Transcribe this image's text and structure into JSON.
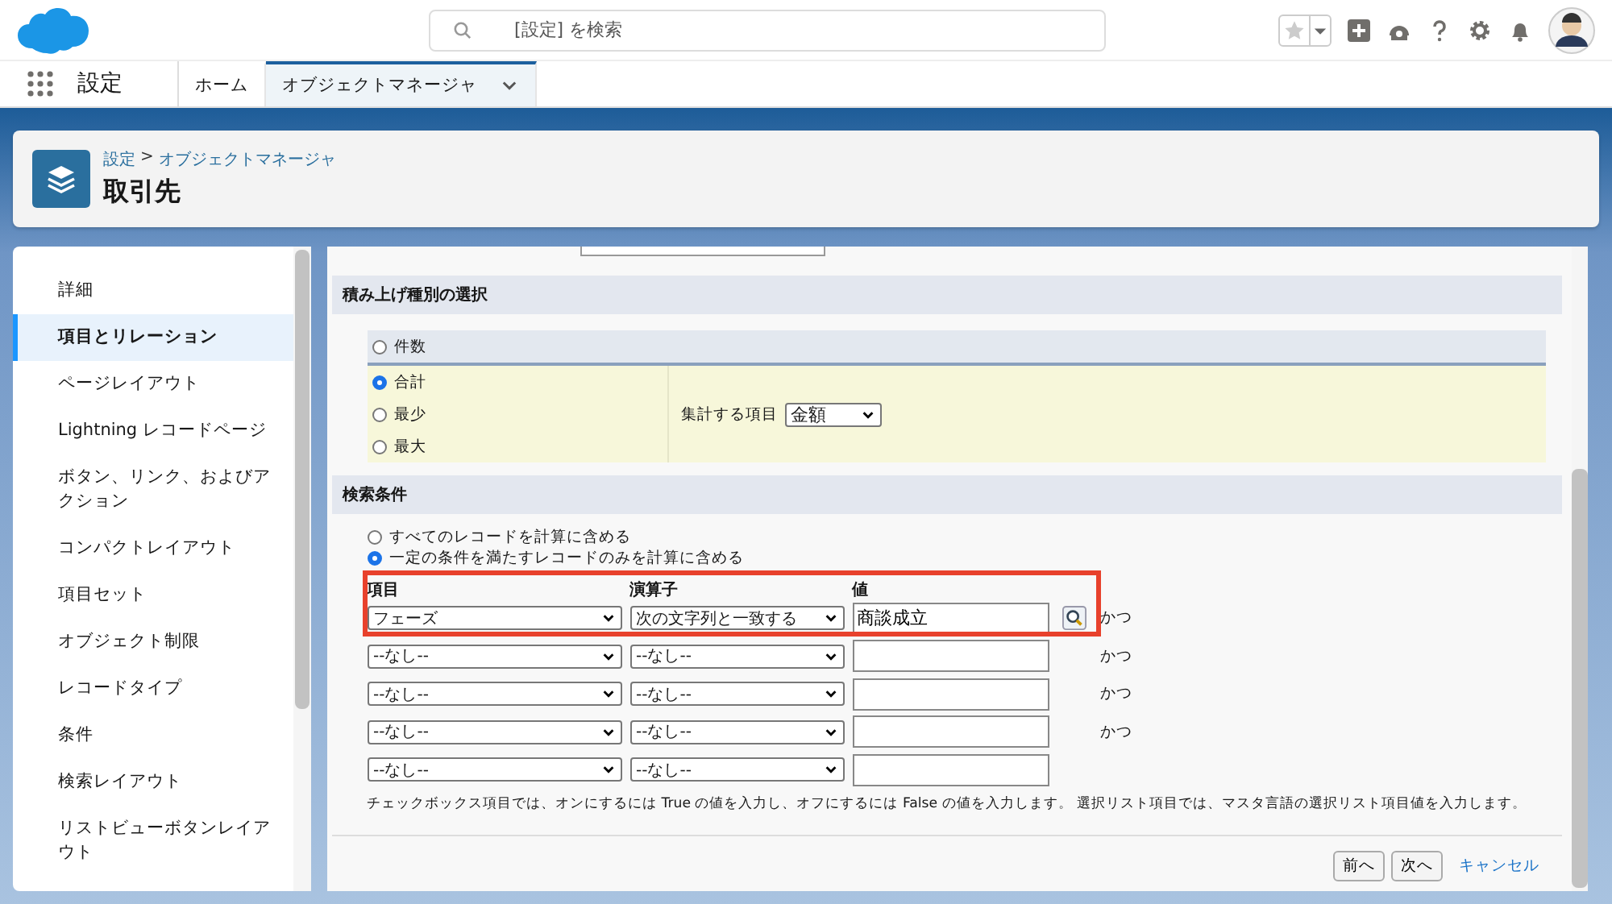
{
  "header": {
    "search_placeholder": "[設定] を検索"
  },
  "nav": {
    "app_title": "設定",
    "tabs": [
      {
        "label": "ホーム",
        "selected": false
      },
      {
        "label": "オブジェクトマネージャ",
        "selected": true
      }
    ]
  },
  "page_header": {
    "breadcrumb": {
      "parent": "設定",
      "separator": ">",
      "current": "オブジェクトマネージャ"
    },
    "title": "取引先"
  },
  "sidebar": {
    "items": [
      {
        "label": "詳細",
        "selected": false
      },
      {
        "label": "項目とリレーション",
        "selected": true
      },
      {
        "label": "ページレイアウト",
        "selected": false
      },
      {
        "label": "Lightning レコードページ",
        "selected": false
      },
      {
        "label": "ボタン、リンク、およびアクション",
        "selected": false
      },
      {
        "label": "コンパクトレイアウト",
        "selected": false
      },
      {
        "label": "項目セット",
        "selected": false
      },
      {
        "label": "オブジェクト制限",
        "selected": false
      },
      {
        "label": "レコードタイプ",
        "selected": false
      },
      {
        "label": "条件",
        "selected": false
      },
      {
        "label": "検索レイアウト",
        "selected": false
      },
      {
        "label": "リストビューボタンレイアウト",
        "selected": false
      }
    ]
  },
  "rollup_section": {
    "title": "積み上げ種別の選択",
    "options": [
      {
        "label": "件数",
        "selected": false
      },
      {
        "label": "合計",
        "selected": true
      },
      {
        "label": "最少",
        "selected": false
      },
      {
        "label": "最大",
        "selected": false
      }
    ],
    "field_label": "集計する項目",
    "field_value": "金額"
  },
  "filter_section": {
    "title": "検索条件",
    "modes": [
      {
        "label": "すべてのレコードを計算に含める",
        "selected": false
      },
      {
        "label": "一定の条件を満たすレコードのみを計算に含める",
        "selected": true
      }
    ],
    "highlighted": true,
    "columns": [
      "項目",
      "演算子",
      "値"
    ],
    "rows": [
      {
        "field": "フェーズ",
        "operator": "次の文字列と一致する",
        "value": "商談成立",
        "lookup": true,
        "conjunction": "かつ"
      },
      {
        "field": "--なし--",
        "operator": "--なし--",
        "value": "",
        "lookup": false,
        "conjunction": "かつ"
      },
      {
        "field": "--なし--",
        "operator": "--なし--",
        "value": "",
        "lookup": false,
        "conjunction": "かつ"
      },
      {
        "field": "--なし--",
        "operator": "--なし--",
        "value": "",
        "lookup": false,
        "conjunction": "かつ"
      },
      {
        "field": "--なし--",
        "operator": "--なし--",
        "value": "",
        "lookup": false
      }
    ],
    "hint": "チェックボックス項目では、オンにするには True の値を入力し、オフにするには False の値を入力します。 選択リスト項目では、マスタ言語の選択リスト項目値を入力します。"
  },
  "buttons": [
    "前へ",
    "次へ"
  ],
  "cancel_link": "キャンセル"
}
